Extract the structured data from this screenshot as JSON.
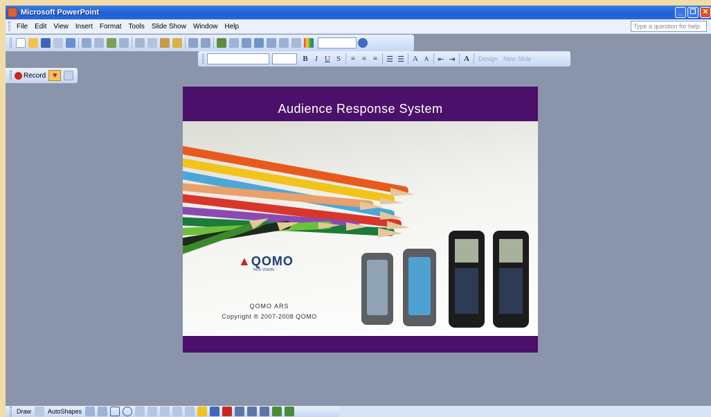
{
  "window": {
    "title": "Microsoft PowerPoint"
  },
  "menu": {
    "items": [
      "File",
      "Edit",
      "View",
      "Insert",
      "Format",
      "Tools",
      "Slide Show",
      "Window",
      "Help"
    ]
  },
  "help_box": {
    "placeholder": "Type a question for help"
  },
  "formatting_toolbar": {
    "design_label": "Design",
    "new_slide_label": "New Slide"
  },
  "record_toolbar": {
    "record_label": "Record"
  },
  "slide": {
    "title": "Audience Response System",
    "logo_text": "QOMO",
    "logo_tagline": "HITE VISION",
    "product_name": "QOMO ARS",
    "copyright": "Copyright ® 2007-2008 QOMO"
  },
  "drawing_toolbar": {
    "draw_label": "Draw",
    "autoshapes_label": "AutoShapes"
  },
  "colors": {
    "titlebar": "#2a66d8",
    "slide_band": "#4b1069",
    "workspace": "#8a95ab"
  }
}
